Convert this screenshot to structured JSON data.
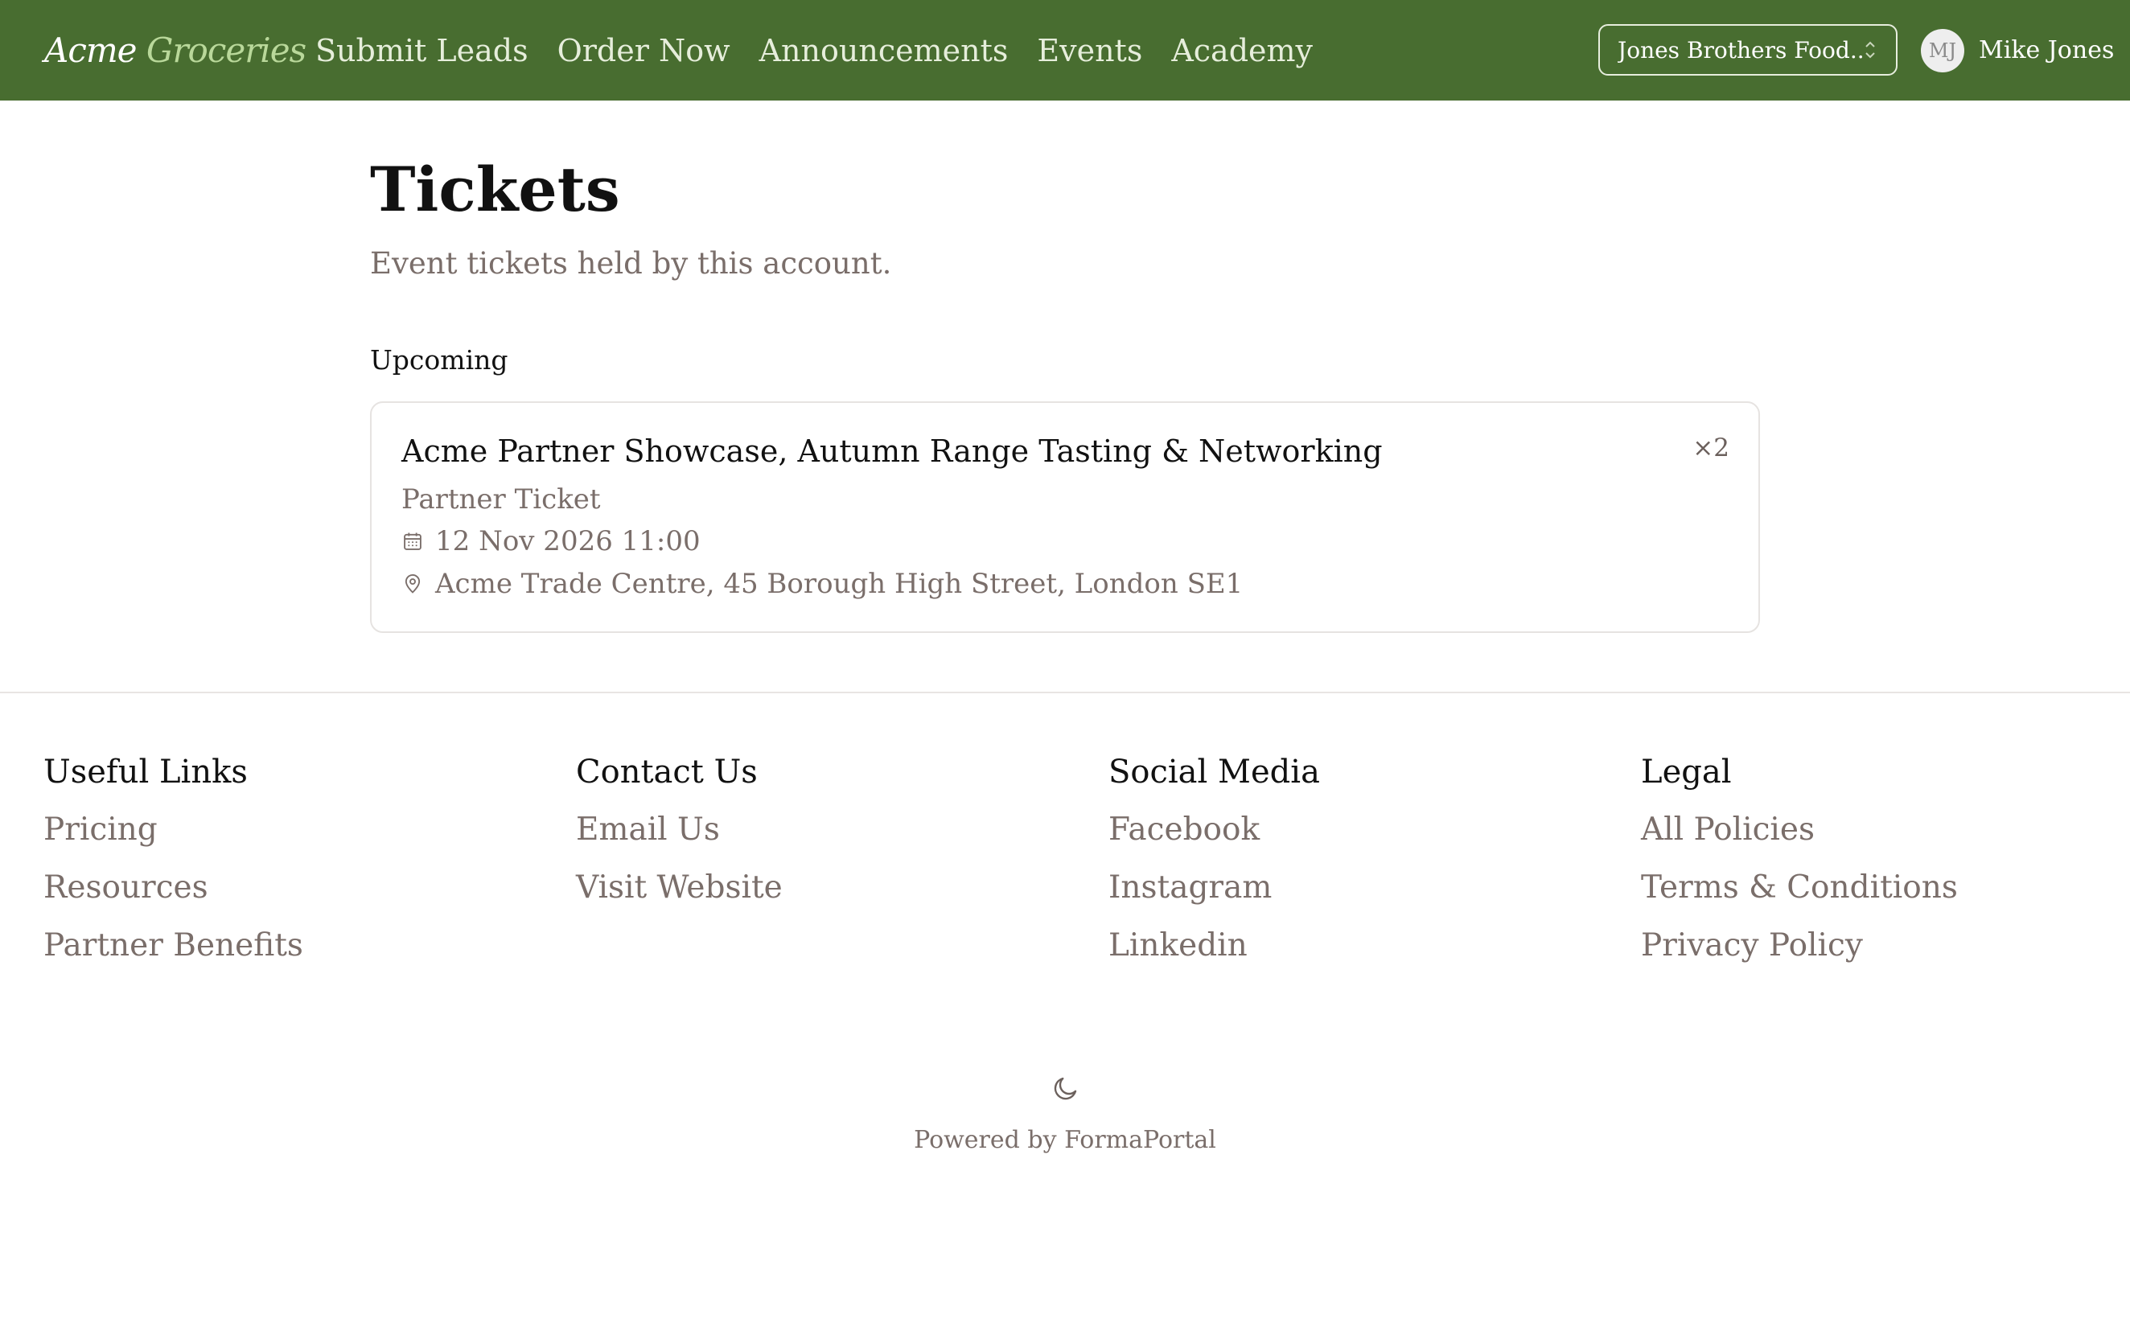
{
  "header": {
    "brand_part1": "Acme",
    "brand_part2": "Groceries",
    "nav": [
      "Submit Leads",
      "Order Now",
      "Announcements",
      "Events",
      "Academy"
    ],
    "org_selector_value": "Jones Brothers Food...",
    "avatar_initials": "MJ",
    "user_name": "Mike Jones"
  },
  "page": {
    "title": "Tickets",
    "subtitle": "Event tickets held by this account.",
    "section_label": "Upcoming"
  },
  "ticket": {
    "event_name": "Acme Partner Showcase, Autumn Range Tasting & Networking",
    "quantity": "×2",
    "ticket_type": "Partner Ticket",
    "datetime": "12 Nov 2026 11:00",
    "location": "Acme Trade Centre, 45 Borough High Street, London SE1",
    "icons": [
      "calendar-icon",
      "map-pin-icon"
    ]
  },
  "footer": {
    "columns": [
      {
        "heading": "Useful Links",
        "links": [
          "Pricing",
          "Resources",
          "Partner Benefits"
        ]
      },
      {
        "heading": "Contact Us",
        "links": [
          "Email Us",
          "Visit Website"
        ]
      },
      {
        "heading": "Social Media",
        "links": [
          "Facebook",
          "Instagram",
          "Linkedin"
        ]
      },
      {
        "heading": "Legal",
        "links": [
          "All Policies",
          "Terms & Conditions",
          "Privacy Policy"
        ]
      }
    ],
    "powered_by": "Powered by FormaPortal"
  },
  "colors": {
    "header_bg": "#486d30",
    "brand_accent": "#b9d89a",
    "muted_text": "#7a6e6a",
    "border": "#e6e3e1"
  }
}
